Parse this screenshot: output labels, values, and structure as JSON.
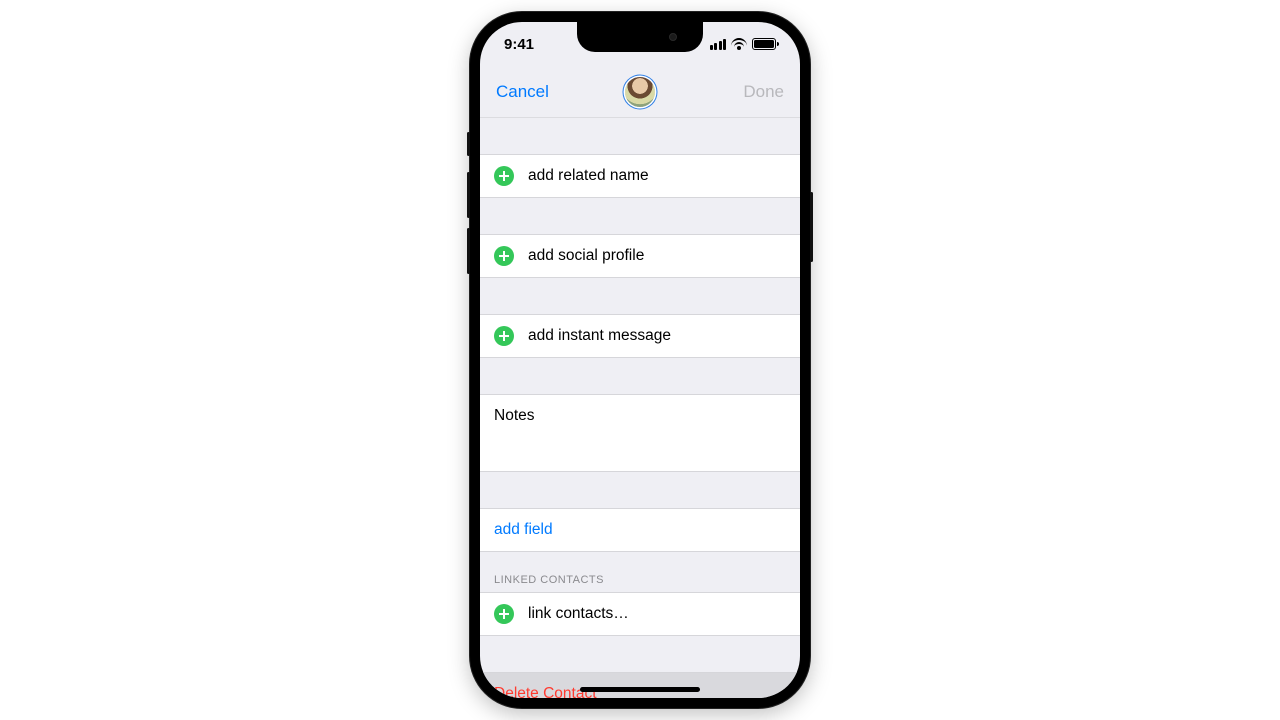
{
  "status": {
    "time": "9:41"
  },
  "nav": {
    "cancel": "Cancel",
    "done": "Done"
  },
  "rows": {
    "related": "add related name",
    "social": "add social profile",
    "im": "add instant message",
    "notes": "Notes",
    "addfield": "add field",
    "link": "link contacts…",
    "delete": "Delete Contact"
  },
  "section": {
    "linked": "LINKED CONTACTS"
  }
}
